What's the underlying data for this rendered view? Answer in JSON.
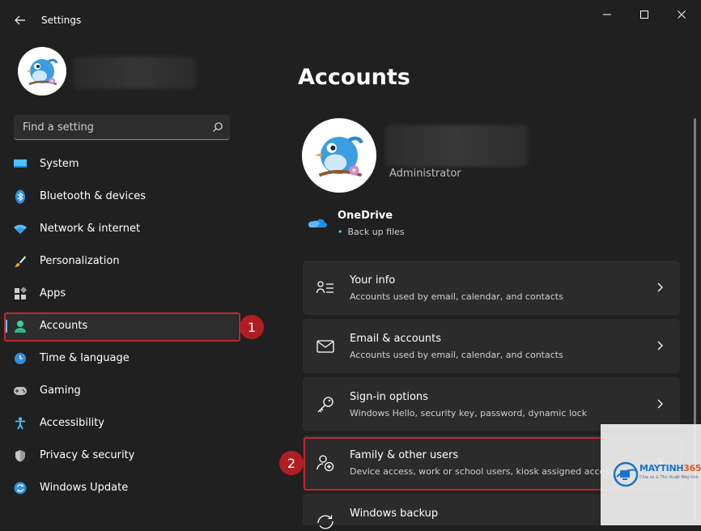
{
  "window": {
    "title": "Settings"
  },
  "sidebar": {
    "search": {
      "placeholder": "Find a setting",
      "value": ""
    },
    "items": [
      {
        "label": "System",
        "icon": "monitor-icon"
      },
      {
        "label": "Bluetooth & devices",
        "icon": "bluetooth-icon"
      },
      {
        "label": "Network & internet",
        "icon": "wifi-icon"
      },
      {
        "label": "Personalization",
        "icon": "brush-icon"
      },
      {
        "label": "Apps",
        "icon": "apps-icon"
      },
      {
        "label": "Accounts",
        "icon": "person-icon",
        "selected": true
      },
      {
        "label": "Time & language",
        "icon": "clock-icon"
      },
      {
        "label": "Gaming",
        "icon": "gamepad-icon"
      },
      {
        "label": "Accessibility",
        "icon": "accessibility-icon"
      },
      {
        "label": "Privacy & security",
        "icon": "shield-icon"
      },
      {
        "label": "Windows Update",
        "icon": "refresh-icon"
      }
    ],
    "step_badge": "1"
  },
  "main": {
    "title": "Accounts",
    "user": {
      "role": "Administrator"
    },
    "onedrive": {
      "title": "OneDrive",
      "subtitle": "Back up files"
    },
    "cards": [
      {
        "title": "Your info",
        "subtitle": "Accounts used by email, calendar, and contacts",
        "icon": "id-card-icon"
      },
      {
        "title": "Email & accounts",
        "subtitle": "Accounts used by email, calendar, and contacts",
        "icon": "mail-icon"
      },
      {
        "title": "Sign-in options",
        "subtitle": "Windows Hello, security key, password, dynamic lock",
        "icon": "key-icon"
      },
      {
        "title": "Family & other users",
        "subtitle": "Device access, work or school users, kiosk assigned access",
        "icon": "person-add-icon"
      },
      {
        "title": "Windows backup",
        "subtitle": "",
        "icon": "backup-icon"
      }
    ],
    "step_badge": "2"
  },
  "watermark": {
    "brand_main": "MAYTINH",
    "brand_accent": "365",
    "tagline": "Chia sẻ & Thủ thuật Máy tính"
  },
  "colors": {
    "background": "#202020",
    "card": "#2b2b2b",
    "accent": "#60cdff",
    "highlight": "#c4242b"
  }
}
